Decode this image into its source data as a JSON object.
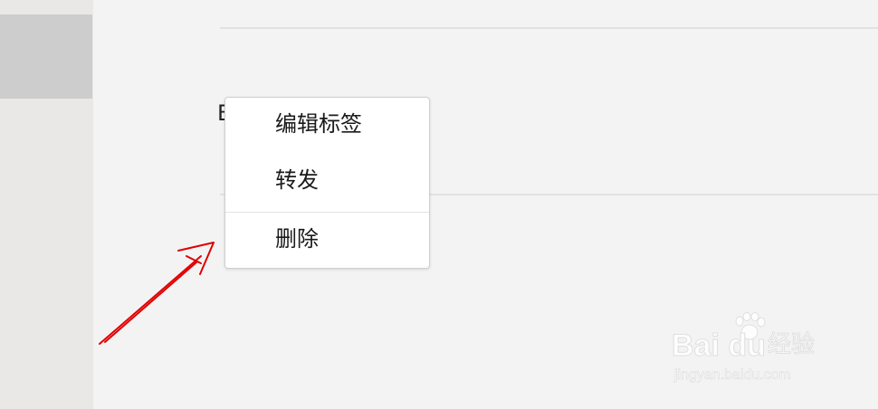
{
  "background_label": "B",
  "context_menu": {
    "items": [
      {
        "label": "编辑标签"
      },
      {
        "label": "转发"
      },
      {
        "label": "删除"
      }
    ]
  },
  "watermark": {
    "logo": "Bai du",
    "sub": "经验",
    "url": "jingyan.baidu.com"
  },
  "colors": {
    "background": "#f3f3f3",
    "sidebar": "#e9e8e7",
    "sidebar_selected": "#cdcdcd",
    "menu_bg": "#ffffff",
    "arrow": "#e00000"
  }
}
